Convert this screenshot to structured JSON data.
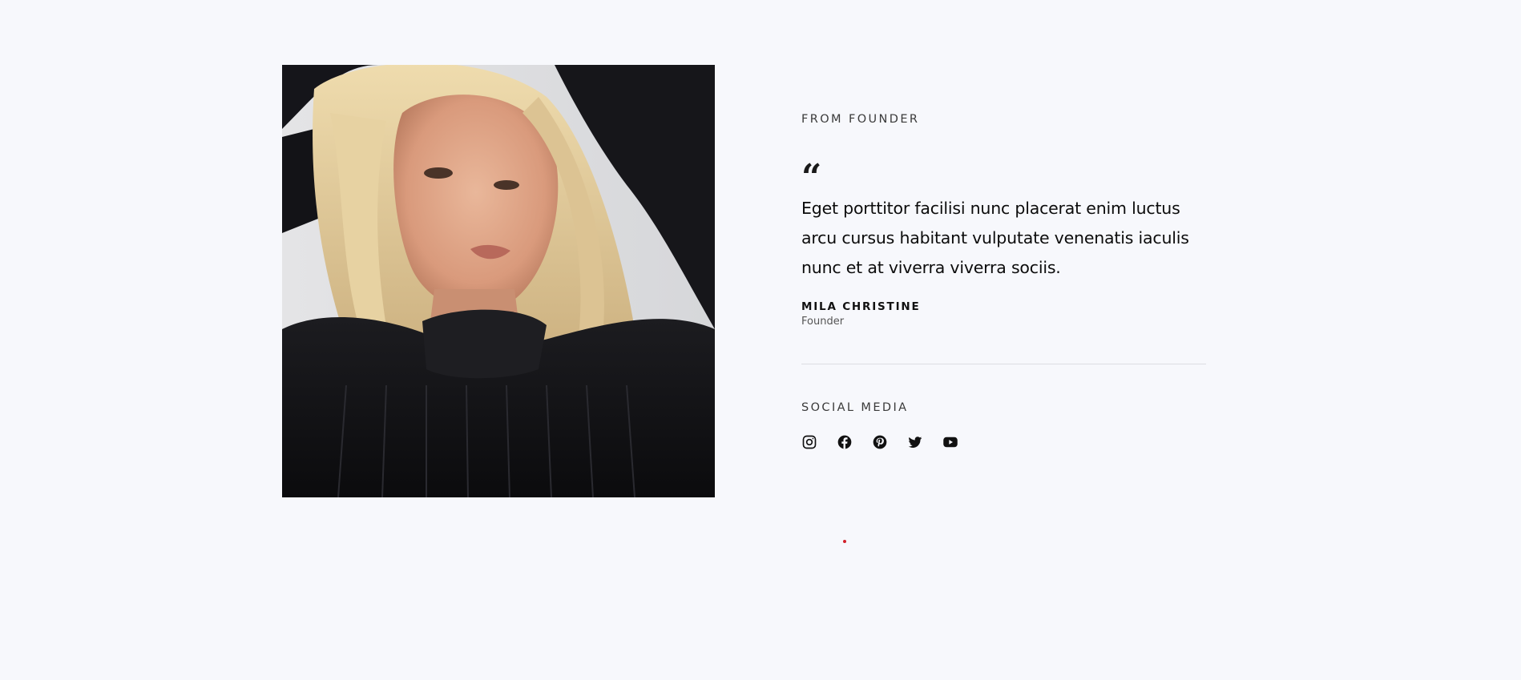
{
  "founder": {
    "eyebrow": "FROM FOUNDER",
    "quote_mark": "“",
    "quote": "Eget porttitor facilisi nunc placerat enim luctus arcu cursus habitant vulputate venenatis iaculis nunc et at viverra viverra sociis.",
    "author_name": "MILA CHRISTINE",
    "author_role": "Founder"
  },
  "social": {
    "title": "SOCIAL MEDIA",
    "icons": [
      "instagram-icon",
      "facebook-icon",
      "pinterest-icon",
      "twitter-icon",
      "youtube-icon"
    ]
  },
  "colors": {
    "background": "#f7f8fc",
    "text": "#111111",
    "divider": "#dcdde2",
    "loader_dot": "#d2202a"
  }
}
